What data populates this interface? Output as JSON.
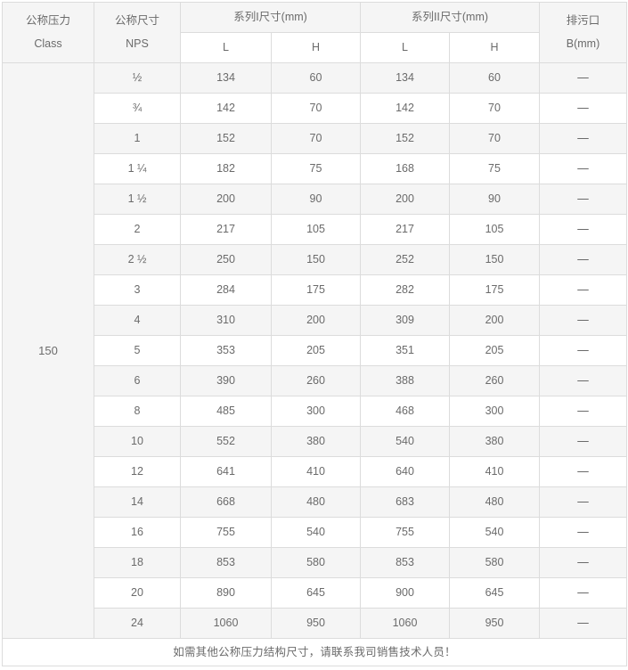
{
  "table": {
    "headers": {
      "class_col": {
        "line1": "公称压力",
        "line2": "Class"
      },
      "nps_col": {
        "line1": "公称尺寸",
        "line2": "NPS"
      },
      "series1": "系列I尺寸(mm)",
      "series2": "系列II尺寸(mm)",
      "drain_col": {
        "line1": "排污口",
        "line2": "B(mm)"
      },
      "sub": {
        "s1_l": "L",
        "s1_h": "H",
        "s2_l": "L",
        "s2_h": "H"
      }
    },
    "class_value": "150",
    "rows": [
      {
        "nps": "½",
        "s1_l": "134",
        "s1_h": "60",
        "s2_l": "134",
        "s2_h": "60",
        "b": "—"
      },
      {
        "nps": "¾",
        "s1_l": "142",
        "s1_h": "70",
        "s2_l": "142",
        "s2_h": "70",
        "b": "—"
      },
      {
        "nps": "1",
        "s1_l": "152",
        "s1_h": "70",
        "s2_l": "152",
        "s2_h": "70",
        "b": "—"
      },
      {
        "nps": "1 ¼",
        "s1_l": "182",
        "s1_h": "75",
        "s2_l": "168",
        "s2_h": "75",
        "b": "—"
      },
      {
        "nps": "1 ½",
        "s1_l": "200",
        "s1_h": "90",
        "s2_l": "200",
        "s2_h": "90",
        "b": "—"
      },
      {
        "nps": "2",
        "s1_l": "217",
        "s1_h": "105",
        "s2_l": "217",
        "s2_h": "105",
        "b": "—"
      },
      {
        "nps": "2 ½",
        "s1_l": "250",
        "s1_h": "150",
        "s2_l": "252",
        "s2_h": "150",
        "b": "—"
      },
      {
        "nps": "3",
        "s1_l": "284",
        "s1_h": "175",
        "s2_l": "282",
        "s2_h": "175",
        "b": "—"
      },
      {
        "nps": "4",
        "s1_l": "310",
        "s1_h": "200",
        "s2_l": "309",
        "s2_h": "200",
        "b": "—"
      },
      {
        "nps": "5",
        "s1_l": "353",
        "s1_h": "205",
        "s2_l": "351",
        "s2_h": "205",
        "b": "—"
      },
      {
        "nps": "6",
        "s1_l": "390",
        "s1_h": "260",
        "s2_l": "388",
        "s2_h": "260",
        "b": "—"
      },
      {
        "nps": "8",
        "s1_l": "485",
        "s1_h": "300",
        "s2_l": "468",
        "s2_h": "300",
        "b": "—"
      },
      {
        "nps": "10",
        "s1_l": "552",
        "s1_h": "380",
        "s2_l": "540",
        "s2_h": "380",
        "b": "—"
      },
      {
        "nps": "12",
        "s1_l": "641",
        "s1_h": "410",
        "s2_l": "640",
        "s2_h": "410",
        "b": "—"
      },
      {
        "nps": "14",
        "s1_l": "668",
        "s1_h": "480",
        "s2_l": "683",
        "s2_h": "480",
        "b": "—"
      },
      {
        "nps": "16",
        "s1_l": "755",
        "s1_h": "540",
        "s2_l": "755",
        "s2_h": "540",
        "b": "—"
      },
      {
        "nps": "18",
        "s1_l": "853",
        "s1_h": "580",
        "s2_l": "853",
        "s2_h": "580",
        "b": "—"
      },
      {
        "nps": "20",
        "s1_l": "890",
        "s1_h": "645",
        "s2_l": "900",
        "s2_h": "645",
        "b": "—"
      },
      {
        "nps": "24",
        "s1_l": "1060",
        "s1_h": "950",
        "s2_l": "1060",
        "s2_h": "950",
        "b": "—"
      }
    ],
    "footer_note": "如需其他公称压力结构尺寸，请联系我司销售技术人员！"
  },
  "colors": {
    "header_bg": "#f5f5f5",
    "row_alt_bg": "#f5f5f5",
    "row_bg": "#ffffff",
    "border": "#dcdcdc",
    "text": "#6b6b6b"
  }
}
